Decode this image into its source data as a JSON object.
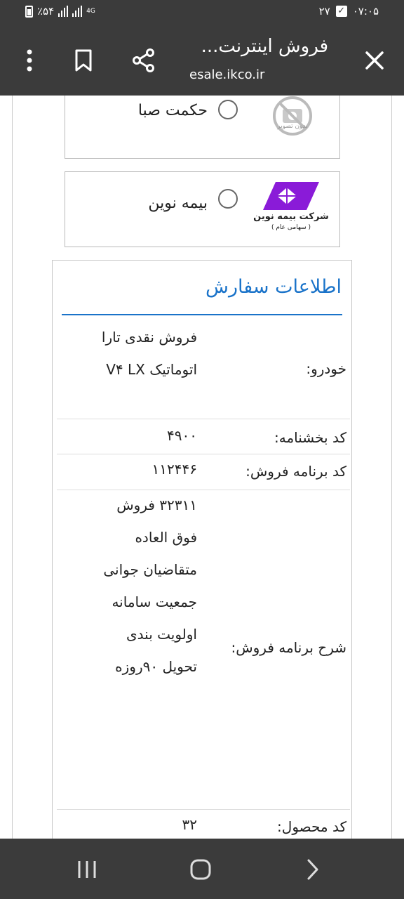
{
  "status_bar": {
    "battery_text": "٪۵۴",
    "network": "4G",
    "date": "۲۷",
    "time": "۰۷:۰۵"
  },
  "toolbar": {
    "title": "فروش اینترنت...",
    "url": "esale.ikco.ir"
  },
  "insurance_options": [
    {
      "name": "حکمت صبا",
      "logo_caption": "بدون تصویر",
      "selected": false
    },
    {
      "name": "بیمه نوین",
      "logo_caption": "شرکت بیمه نوین",
      "logo_subcaption": "( سهامی عام )",
      "selected": false
    }
  ],
  "order": {
    "title": "اطلاعات سفارش",
    "rows": [
      {
        "label": "خودرو:",
        "value": "فروش نقدی تارا اتوماتیک V۴ LX"
      },
      {
        "label": "کد بخشنامه:",
        "value": "۴۹۰۰"
      },
      {
        "label": "کد برنامه فروش:",
        "value": "۱۱۲۴۴۶"
      },
      {
        "label": "شرح برنامه فروش:",
        "value": "۳۲۳۱۱ فروش فوق العاده متقاضیان جوانی جمعیت سامانه اولویت بندی تحویل ۹۰روزه"
      },
      {
        "label": "کد محصول:",
        "value": "۳۲"
      }
    ]
  },
  "colors": {
    "chrome": "#3b3b3b",
    "accent": "#1a73c9",
    "novin_purple": "#8a1bd8"
  }
}
